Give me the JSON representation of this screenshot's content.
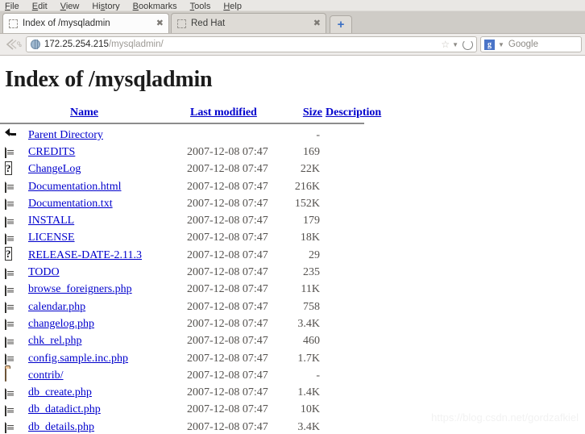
{
  "browser": {
    "menus": [
      {
        "label": "File",
        "accel": "F"
      },
      {
        "label": "Edit",
        "accel": "E"
      },
      {
        "label": "View",
        "accel": "V"
      },
      {
        "label": "History",
        "accel": "s"
      },
      {
        "label": "Bookmarks",
        "accel": "B"
      },
      {
        "label": "Tools",
        "accel": "T"
      },
      {
        "label": "Help",
        "accel": "H"
      }
    ],
    "tabs": [
      {
        "title": "Index of /mysqladmin",
        "active": true,
        "close_icon": "close-icon"
      },
      {
        "title": "Red Hat",
        "active": false,
        "close_icon": "close-icon"
      }
    ],
    "new_tab_label": "+",
    "address": {
      "host": "172.25.254.215",
      "path": "/mysqladmin/",
      "globe_icon": "globe-icon",
      "star_icon": "star-icon",
      "caret_icon": "chevron-down-icon",
      "reload_icon": "reload-icon"
    },
    "search": {
      "engine_glyph": "g",
      "engine_label": "Google",
      "caret_icon": "chevron-down-icon"
    }
  },
  "page": {
    "title": "Index of /mysqladmin",
    "headers": {
      "name": "Name",
      "last_modified": "Last modified",
      "size": "Size",
      "description": "Description"
    },
    "rows": [
      {
        "icon": "back-icon",
        "name": "Parent Directory",
        "date": "",
        "size": "-",
        "desc": ""
      },
      {
        "icon": "doc-icon",
        "name": "CREDITS",
        "date": "2007-12-08 07:47",
        "size": "169",
        "desc": ""
      },
      {
        "icon": "unknown-icon",
        "name": "ChangeLog",
        "date": "2007-12-08 07:47",
        "size": "22K",
        "desc": ""
      },
      {
        "icon": "doc-icon",
        "name": "Documentation.html",
        "date": "2007-12-08 07:47",
        "size": "216K",
        "desc": ""
      },
      {
        "icon": "doc-icon",
        "name": "Documentation.txt",
        "date": "2007-12-08 07:47",
        "size": "152K",
        "desc": ""
      },
      {
        "icon": "doc-icon",
        "name": "INSTALL",
        "date": "2007-12-08 07:47",
        "size": "179",
        "desc": ""
      },
      {
        "icon": "doc-icon",
        "name": "LICENSE",
        "date": "2007-12-08 07:47",
        "size": "18K",
        "desc": ""
      },
      {
        "icon": "unknown-icon",
        "name": "RELEASE-DATE-2.11.3",
        "date": "2007-12-08 07:47",
        "size": "29",
        "desc": ""
      },
      {
        "icon": "doc-icon",
        "name": "TODO",
        "date": "2007-12-08 07:47",
        "size": "235",
        "desc": ""
      },
      {
        "icon": "doc-icon",
        "name": "browse_foreigners.php",
        "date": "2007-12-08 07:47",
        "size": "11K",
        "desc": ""
      },
      {
        "icon": "doc-icon",
        "name": "calendar.php",
        "date": "2007-12-08 07:47",
        "size": "758",
        "desc": ""
      },
      {
        "icon": "doc-icon",
        "name": "changelog.php",
        "date": "2007-12-08 07:47",
        "size": "3.4K",
        "desc": ""
      },
      {
        "icon": "doc-icon",
        "name": "chk_rel.php",
        "date": "2007-12-08 07:47",
        "size": "460",
        "desc": ""
      },
      {
        "icon": "doc-icon",
        "name": "config.sample.inc.php",
        "date": "2007-12-08 07:47",
        "size": "1.7K",
        "desc": ""
      },
      {
        "icon": "folder-icon",
        "name": "contrib/",
        "date": "2007-12-08 07:47",
        "size": "-",
        "desc": ""
      },
      {
        "icon": "doc-icon",
        "name": "db_create.php",
        "date": "2007-12-08 07:47",
        "size": "1.4K",
        "desc": ""
      },
      {
        "icon": "doc-icon",
        "name": "db_datadict.php",
        "date": "2007-12-08 07:47",
        "size": "10K",
        "desc": ""
      },
      {
        "icon": "doc-icon",
        "name": "db_details.php",
        "date": "2007-12-08 07:47",
        "size": "3.4K",
        "desc": ""
      }
    ]
  },
  "watermark": "https://blog.csdn.net/gordzafkiel",
  "colors": {
    "link": "#0000cc",
    "chrome_bg": "#eeecea",
    "tabstrip_bg": "#cfccc7",
    "folder": "#f0c79a"
  }
}
